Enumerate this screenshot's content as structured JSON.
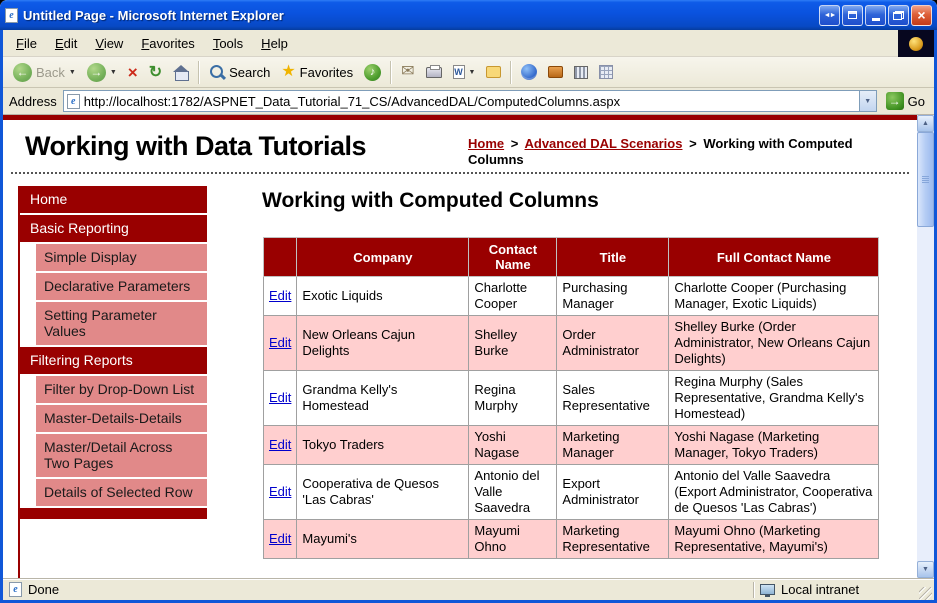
{
  "window": {
    "title": "Untitled Page - Microsoft Internet Explorer"
  },
  "menu": {
    "items": [
      "File",
      "Edit",
      "View",
      "Favorites",
      "Tools",
      "Help"
    ]
  },
  "toolbar": {
    "back": "Back",
    "search": "Search",
    "favorites": "Favorites"
  },
  "address": {
    "label": "Address",
    "url": "http://localhost:1782/ASPNET_Data_Tutorial_71_CS/AdvancedDAL/ComputedColumns.aspx",
    "go": "Go"
  },
  "site": {
    "title": "Working with Data Tutorials",
    "breadcrumb": {
      "home": "Home",
      "sep": ">",
      "section": "Advanced DAL Scenarios",
      "current": "Working with Computed Columns"
    }
  },
  "sidebar": {
    "items": [
      {
        "label": "Home",
        "type": "header"
      },
      {
        "label": "Basic Reporting",
        "type": "header"
      },
      {
        "label": "Simple Display",
        "type": "sub"
      },
      {
        "label": "Declarative Parameters",
        "type": "sub"
      },
      {
        "label": "Setting Parameter Values",
        "type": "sub"
      },
      {
        "label": "Filtering Reports",
        "type": "header"
      },
      {
        "label": "Filter by Drop-Down List",
        "type": "sub"
      },
      {
        "label": "Master-Details-Details",
        "type": "sub"
      },
      {
        "label": "Master/Detail Across Two Pages",
        "type": "sub"
      },
      {
        "label": "Details of Selected Row",
        "type": "sub"
      }
    ]
  },
  "main": {
    "heading": "Working with Computed Columns",
    "table": {
      "edit": "Edit",
      "headers": [
        "",
        "Company",
        "Contact Name",
        "Title",
        "Full Contact Name"
      ],
      "rows": [
        {
          "company": "Exotic Liquids",
          "contact": "Charlotte Cooper",
          "title": "Purchasing Manager",
          "full": "Charlotte Cooper (Purchasing Manager, Exotic Liquids)"
        },
        {
          "company": "New Orleans Cajun Delights",
          "contact": "Shelley Burke",
          "title": "Order Administrator",
          "full": "Shelley Burke (Order Administrator, New Orleans Cajun Delights)"
        },
        {
          "company": "Grandma Kelly's Homestead",
          "contact": "Regina Murphy",
          "title": "Sales Representative",
          "full": "Regina Murphy (Sales Representative, Grandma Kelly's Homestead)"
        },
        {
          "company": "Tokyo Traders",
          "contact": "Yoshi Nagase",
          "title": "Marketing Manager",
          "full": "Yoshi Nagase (Marketing Manager, Tokyo Traders)"
        },
        {
          "company": "Cooperativa de Quesos 'Las Cabras'",
          "contact": "Antonio del Valle Saavedra",
          "title": "Export Administrator",
          "full": "Antonio del Valle Saavedra (Export Administrator, Cooperativa de Quesos 'Las Cabras')"
        },
        {
          "company": "Mayumi's",
          "contact": "Mayumi Ohno",
          "title": "Marketing Representative",
          "full": "Mayumi Ohno (Marketing Representative, Mayumi's)"
        }
      ]
    }
  },
  "status": {
    "left": "Done",
    "right": "Local intranet"
  },
  "colors": {
    "maroon": "#990000",
    "salmon": "#E18989",
    "row_alt": "#FFCFCF",
    "xp_blue": "#1057D8",
    "link_blue": "#0000CC"
  }
}
